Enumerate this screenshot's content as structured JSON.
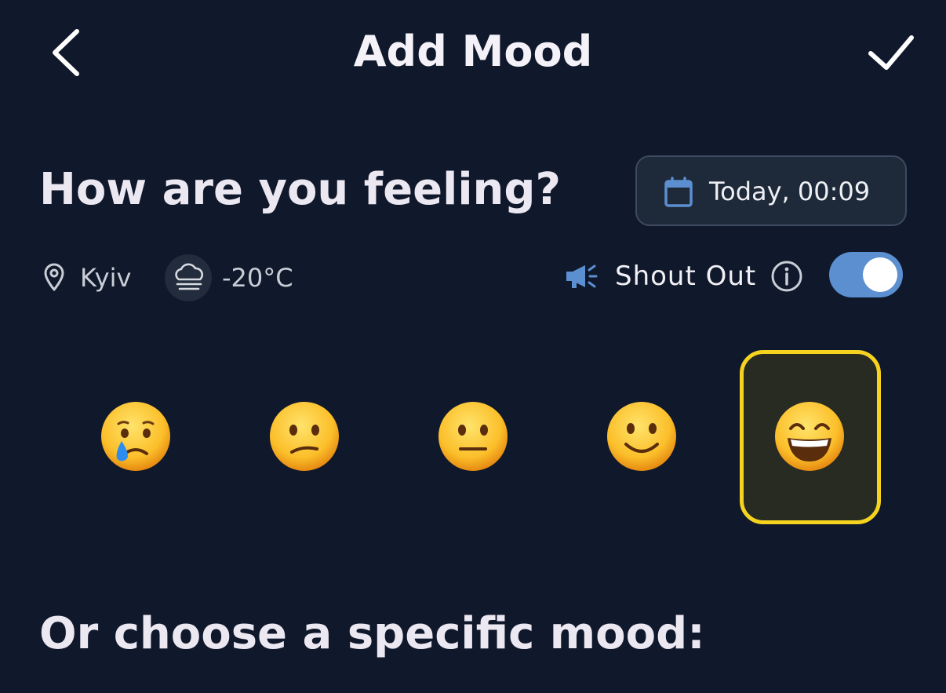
{
  "header": {
    "title": "Add Mood",
    "back_icon": "chevron-left-icon",
    "confirm_icon": "checkmark-icon"
  },
  "feeling": {
    "question": "How are you feeling?",
    "date_label": "Today, 00:09",
    "date_icon": "calendar-icon"
  },
  "meta": {
    "location": "Kyiv",
    "location_icon": "map-pin-icon",
    "temperature": "-20°C",
    "weather_icon": "cloudy-fog-icon"
  },
  "shout_out": {
    "label": "Shout Out",
    "icon": "megaphone-icon",
    "info_icon": "info-icon",
    "enabled": true
  },
  "moods": [
    {
      "name": "crying",
      "selected": false
    },
    {
      "name": "confused",
      "selected": false
    },
    {
      "name": "neutral",
      "selected": false
    },
    {
      "name": "slightly-smiling",
      "selected": false
    },
    {
      "name": "grinning",
      "selected": true
    }
  ],
  "specific_mood": {
    "title": "Or choose a specific mood:"
  },
  "colors": {
    "background": "#10182b",
    "accent_blue": "#5b8fd0",
    "selection_yellow": "#f6d31f",
    "text_primary": "#ece8f2"
  }
}
